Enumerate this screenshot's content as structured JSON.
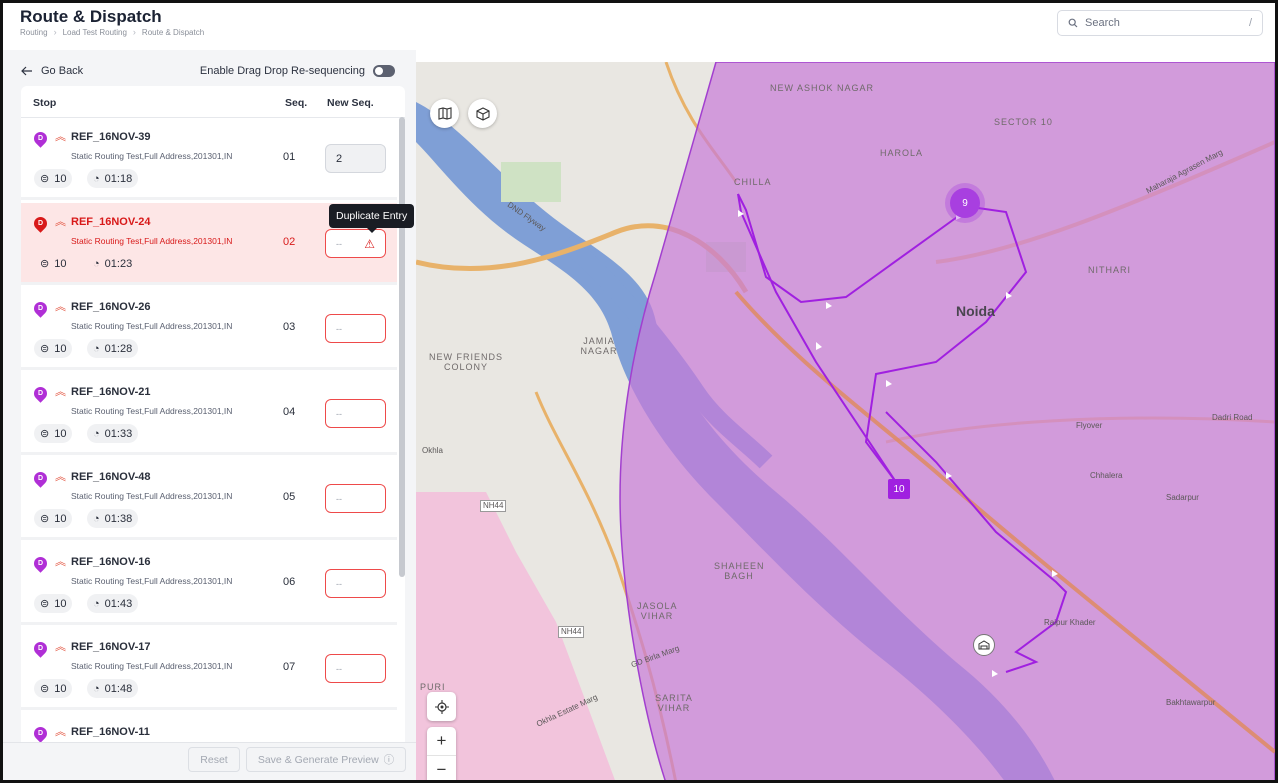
{
  "header": {
    "title": "Route & Dispatch",
    "breadcrumb": [
      "Routing",
      "Load Test Routing",
      "Route & Dispatch"
    ],
    "search_placeholder": "Search",
    "search_shortcut": "/"
  },
  "panel": {
    "go_back": "Go Back",
    "drag_drop_label": "Enable Drag Drop Re-sequencing",
    "columns": {
      "stop": "Stop",
      "seq": "Seq.",
      "new_seq": "New Seq."
    },
    "tooltip": "Duplicate Entry",
    "rows": [
      {
        "badge": "D",
        "ref": "REF_16NOV-39",
        "address": "Static Routing Test,Full Address,201301,IN",
        "seq": "01",
        "count": "10",
        "time": "01:18",
        "new_seq": "2",
        "error": false
      },
      {
        "badge": "D",
        "ref": "REF_16NOV-24",
        "address": "Static Routing Test,Full Address,201301,IN",
        "seq": "02",
        "count": "10",
        "time": "01:23",
        "new_seq": "--",
        "error": true
      },
      {
        "badge": "D",
        "ref": "REF_16NOV-26",
        "address": "Static Routing Test,Full Address,201301,IN",
        "seq": "03",
        "count": "10",
        "time": "01:28",
        "new_seq": "--",
        "error": false
      },
      {
        "badge": "D",
        "ref": "REF_16NOV-21",
        "address": "Static Routing Test,Full Address,201301,IN",
        "seq": "04",
        "count": "10",
        "time": "01:33",
        "new_seq": "--",
        "error": false
      },
      {
        "badge": "D",
        "ref": "REF_16NOV-48",
        "address": "Static Routing Test,Full Address,201301,IN",
        "seq": "05",
        "count": "10",
        "time": "01:38",
        "new_seq": "--",
        "error": false
      },
      {
        "badge": "D",
        "ref": "REF_16NOV-16",
        "address": "Static Routing Test,Full Address,201301,IN",
        "seq": "06",
        "count": "10",
        "time": "01:43",
        "new_seq": "--",
        "error": false
      },
      {
        "badge": "D",
        "ref": "REF_16NOV-17",
        "address": "Static Routing Test,Full Address,201301,IN",
        "seq": "07",
        "count": "10",
        "time": "01:48",
        "new_seq": "--",
        "error": false
      },
      {
        "badge": "D",
        "ref": "REF_16NOV-11"
      }
    ],
    "reset": "Reset",
    "save": "Save & Generate Preview"
  },
  "map": {
    "labels": {
      "new_ashok_nagar": "NEW ASHOK NAGAR",
      "sector10": "SECTOR 10",
      "harola": "HAROLA",
      "chilla": "CHILLA",
      "nithari": "NITHARI",
      "noida": "Noida",
      "jamia": "JAMIA NAGAR",
      "nfc": "NEW FRIENDS COLONY",
      "shaheen": "SHAHEEN BAGH",
      "jasola": "JASOLA VIHAR",
      "sarita": "SARITA VIHAR",
      "chhalera": "Chhalera",
      "sadarpur": "Sadarpur",
      "raipur": "Raipur Khader",
      "bakhtawarpur": "Bakhtawarpur",
      "dadri": "Dadri Road",
      "flyover": "Flyover",
      "dnd": "DND Flyway",
      "okhla": "Okhla",
      "puri": "PURI",
      "nh44a": "NH44",
      "nh44b": "NH44",
      "mahamaya": "Maharaja Agrasen Marg",
      "ddgmarg": "GD Birla Marg",
      "okhla_estate": "Okhla Estate Marg"
    },
    "cluster": "9",
    "marker": "10",
    "route_color": "#a020e0",
    "zone_color": "#c77bd8"
  }
}
